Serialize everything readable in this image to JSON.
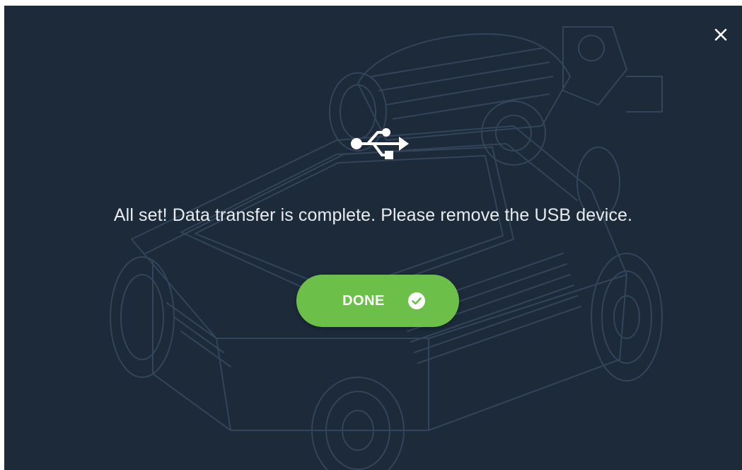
{
  "dialog": {
    "message": "All set! Data transfer is complete. Please remove the USB device.",
    "done_label": "DONE"
  },
  "icons": {
    "close": "close-icon",
    "usb": "usb-icon",
    "check": "check-circle-icon",
    "background": "robot-line-art"
  },
  "colors": {
    "background": "#1c2a3a",
    "text": "#e8ecf0",
    "accent": "#6cc04a",
    "line_art": "#2f3f52"
  }
}
